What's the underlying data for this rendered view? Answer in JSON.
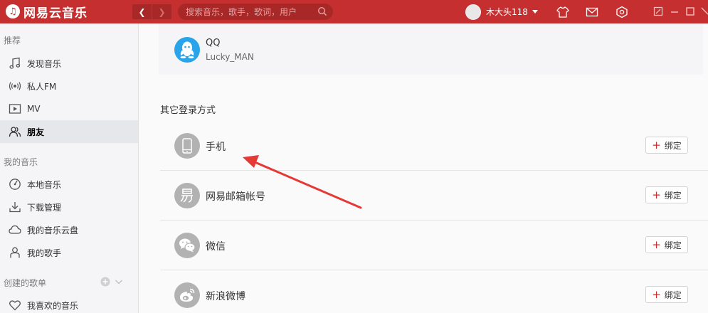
{
  "app": {
    "logo_glyph": "♫",
    "title": "网易云音乐"
  },
  "nav": {
    "back_glyph": "❮",
    "forward_glyph": "❯"
  },
  "search": {
    "placeholder": "搜索音乐，歌手，歌词，用户"
  },
  "user": {
    "name": "木大头118"
  },
  "sidebar": {
    "sections": [
      {
        "title": "推荐"
      },
      {
        "title": "我的音乐"
      },
      {
        "title": "创建的歌单"
      }
    ],
    "items": [
      {
        "label": "发现音乐",
        "icon": "music-note-icon"
      },
      {
        "label": "私人FM",
        "icon": "radio-icon"
      },
      {
        "label": "MV",
        "icon": "video-icon"
      },
      {
        "label": "朋友",
        "icon": "friends-icon"
      },
      {
        "label": "本地音乐",
        "icon": "local-music-icon"
      },
      {
        "label": "下载管理",
        "icon": "download-icon"
      },
      {
        "label": "我的音乐云盘",
        "icon": "cloud-icon"
      },
      {
        "label": "我的歌手",
        "icon": "singer-icon"
      },
      {
        "label": "我喜欢的音乐",
        "icon": "heart-icon"
      }
    ]
  },
  "main": {
    "qq": {
      "name": "QQ",
      "username": "Lucky_MAN"
    },
    "other_title": "其它登录方式",
    "bind_label": "绑定",
    "methods": [
      {
        "label": "手机",
        "icon": "phone-icon"
      },
      {
        "label": "网易邮箱帐号",
        "icon": "netease-mail-icon"
      },
      {
        "label": "微信",
        "icon": "wechat-icon"
      },
      {
        "label": "新浪微博",
        "icon": "weibo-icon"
      }
    ]
  },
  "colors": {
    "brand": "#c62f2f",
    "qq": "#29a3e9",
    "annotation_arrow": "#e53935"
  }
}
